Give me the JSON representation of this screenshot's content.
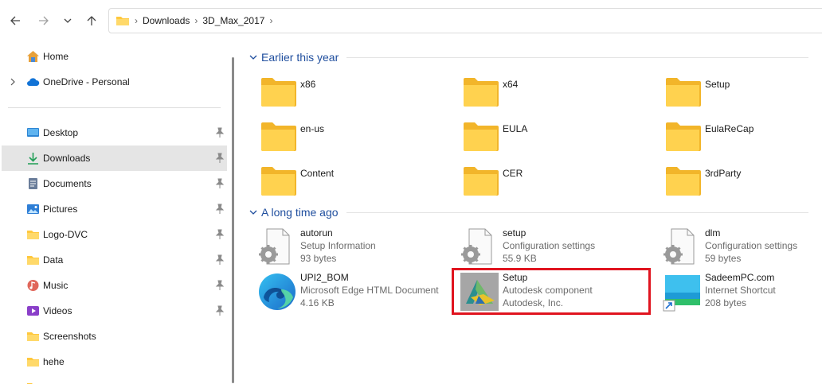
{
  "nav": {
    "back_icon": "arrow-left-icon",
    "forward_icon": "arrow-right-icon",
    "recent_icon": "chevron-down-icon",
    "up_icon": "arrow-up-icon"
  },
  "address": {
    "crumbs": [
      "Downloads",
      "3D_Max_2017"
    ]
  },
  "sidebar": {
    "top_items": [
      {
        "label": "Home",
        "icon": "home-icon"
      },
      {
        "label": "OneDrive - Personal",
        "icon": "cloud-icon"
      }
    ],
    "quick_items": [
      {
        "label": "Desktop",
        "icon": "desktop-icon",
        "pinned": true
      },
      {
        "label": "Downloads",
        "icon": "download-icon",
        "pinned": true,
        "selected": true
      },
      {
        "label": "Documents",
        "icon": "document-icon",
        "pinned": true
      },
      {
        "label": "Pictures",
        "icon": "pictures-icon",
        "pinned": true
      },
      {
        "label": "Logo-DVC",
        "icon": "folder-icon",
        "pinned": true
      },
      {
        "label": "Data",
        "icon": "folder-icon",
        "pinned": true
      },
      {
        "label": "Music",
        "icon": "music-icon",
        "pinned": true
      },
      {
        "label": "Videos",
        "icon": "videos-icon",
        "pinned": true
      },
      {
        "label": "Screenshots",
        "icon": "folder-icon",
        "pinned": false
      },
      {
        "label": "hehe",
        "icon": "folder-icon",
        "pinned": false
      }
    ]
  },
  "groups": {
    "earlier": {
      "title": "Earlier this year",
      "folders": [
        "x86",
        "x64",
        "Setup",
        "en-us",
        "EULA",
        "EulaReCap",
        "Content",
        "CER",
        "3rdParty"
      ]
    },
    "longago": {
      "title": "A long time ago",
      "files": [
        {
          "name": "autorun",
          "type": "Setup Information",
          "detail": "93 bytes",
          "icon": "settings-file-icon"
        },
        {
          "name": "setup",
          "type": "Configuration settings",
          "detail": "55.9 KB",
          "icon": "settings-file-icon"
        },
        {
          "name": "dlm",
          "type": "Configuration settings",
          "detail": "59 bytes",
          "icon": "settings-file-icon"
        },
        {
          "name": "UPI2_BOM",
          "type": "Microsoft Edge HTML Document",
          "detail": "4.16 KB",
          "icon": "edge-icon"
        },
        {
          "name": "Setup",
          "type": "Autodesk component",
          "detail": "Autodesk, Inc.",
          "icon": "autodesk-setup-icon"
        },
        {
          "name": "SadeemPC.com",
          "type": "Internet Shortcut",
          "detail": "208 bytes",
          "icon": "internet-shortcut-icon"
        }
      ]
    }
  },
  "colors": {
    "accent_text": "#1f4e9e",
    "folder_yellow": "#ffc83d",
    "highlight_red": "#e0141f",
    "selected_bg": "#e5e5e5"
  }
}
